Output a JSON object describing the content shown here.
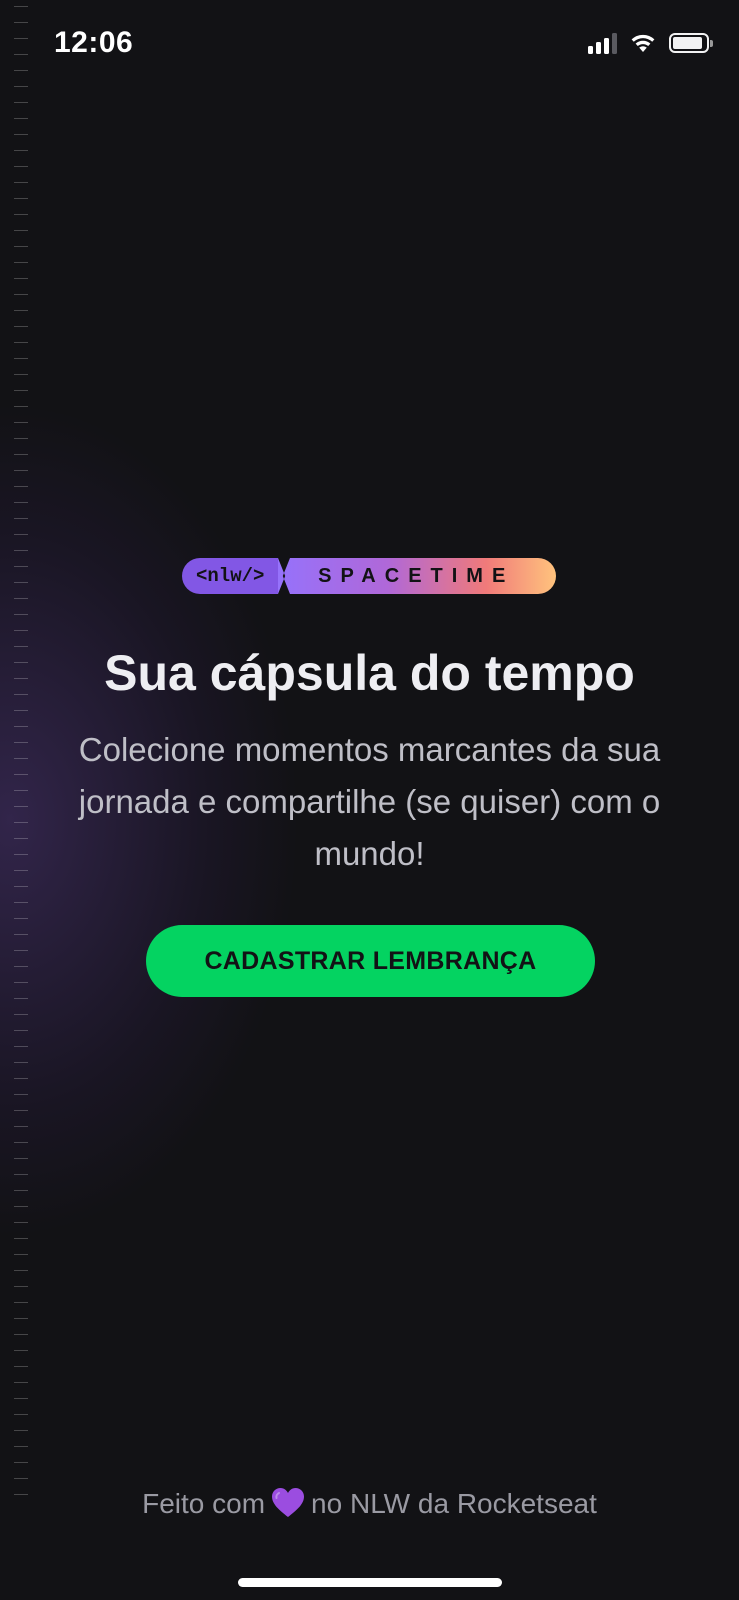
{
  "status_bar": {
    "time": "12:06",
    "icons": [
      "signal-icon",
      "wifi-icon",
      "battery-icon"
    ],
    "battery_level": 0.9
  },
  "logo": {
    "nlw": "<nlw/>",
    "spacetime": "SPACETIME"
  },
  "hero": {
    "title": "Sua cápsula do tempo",
    "subtitle": "Colecione momentos marcantes da sua jornada e compartilhe (se quiser) com o mundo!"
  },
  "cta": {
    "label": "CADASTRAR LEMBRANÇA"
  },
  "footer": {
    "prefix": "Feito com",
    "icon": "purple-heart-icon",
    "suffix": "no NLW da Rocketseat"
  },
  "colors": {
    "background": "#121215",
    "accent_green": "#04d361",
    "accent_purple": "#8257e5",
    "gradient_end": "#ffc37d"
  }
}
